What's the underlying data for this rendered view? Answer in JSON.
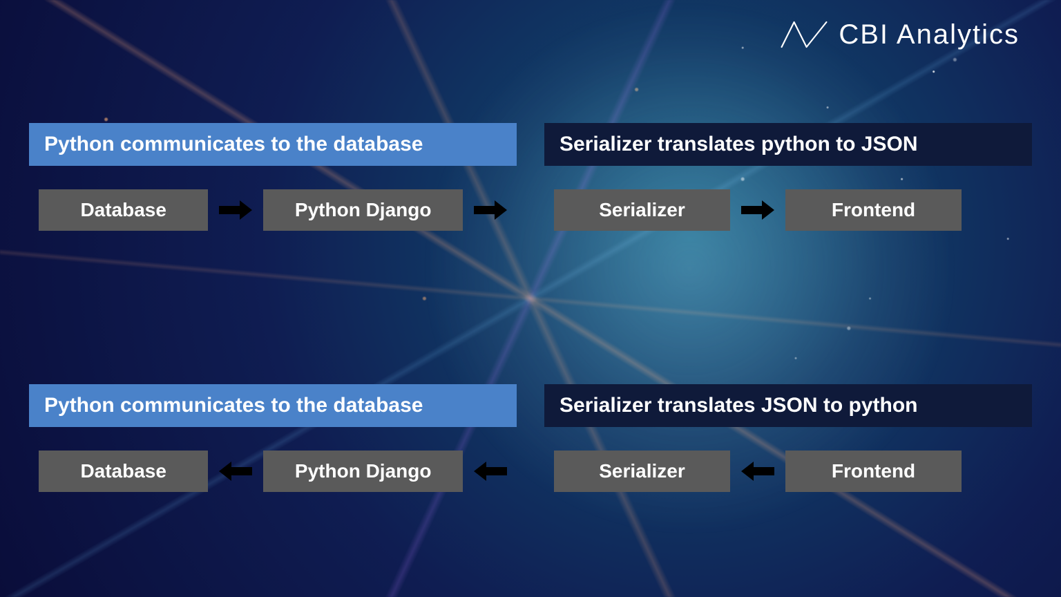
{
  "logo": {
    "text": "CBI Analytics"
  },
  "row1": {
    "left": {
      "banner": "Python communicates to the database",
      "box1": "Database",
      "box2": "Python Django",
      "dir": "right"
    },
    "right": {
      "banner": "Serializer translates python to JSON",
      "box1": "Serializer",
      "box2": "Frontend",
      "dir": "right"
    },
    "mid_dir": "right"
  },
  "row2": {
    "left": {
      "banner": "Python communicates to the database",
      "box1": "Database",
      "box2": "Python Django",
      "dir": "left"
    },
    "right": {
      "banner": "Serializer translates JSON to python",
      "box1": "Serializer",
      "box2": "Frontend",
      "dir": "left"
    },
    "mid_dir": "left"
  },
  "colors": {
    "banner_blue": "#4a82c9",
    "banner_dark": "#0f1a3a",
    "box_gray": "#5a5a5a",
    "arrow": "#ffffff"
  }
}
